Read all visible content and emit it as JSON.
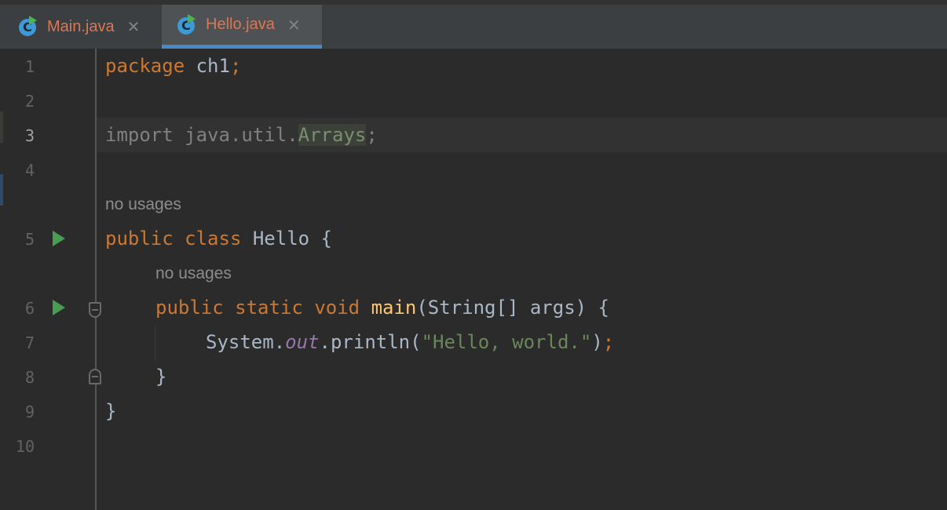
{
  "tabs": [
    {
      "label": "Main.java",
      "icon": "java-class-icon",
      "active": false
    },
    {
      "label": "Hello.java",
      "icon": "java-class-icon",
      "active": true
    }
  ],
  "close_glyph": "✕",
  "file_icon_letter": "C",
  "lines": [
    "1",
    "2",
    "3",
    "4",
    "5",
    "6",
    "7",
    "8",
    "9",
    "10"
  ],
  "hints": {
    "class_usages": "no usages",
    "method_usages": "no usages"
  },
  "code": {
    "l1": {
      "kw": "package",
      "rest": " ch1",
      "semi": ";"
    },
    "l3": {
      "kw": "import",
      "pkg": " java.util.",
      "cls": "Arrays",
      "semi": ";"
    },
    "l5": {
      "kw1": "public",
      "kw2": "class",
      "name": " Hello {"
    },
    "l6": {
      "kw1": "public",
      "kw2": "static",
      "kw3": "void",
      "fn": "main",
      "args": "(String[] args) {"
    },
    "l7": {
      "obj": "System.",
      "field": "out",
      "call": ".println(",
      "str": "\"Hello, world.\"",
      "close": ")",
      "semi": ";"
    },
    "l8": "}",
    "l9": "}"
  },
  "colors": {
    "keyword": "#cc7832",
    "function": "#ffc66d",
    "string": "#6a8759",
    "field": "#9876aa",
    "tab_active_underline": "#4a88c7",
    "tab_text": "#d87756"
  }
}
